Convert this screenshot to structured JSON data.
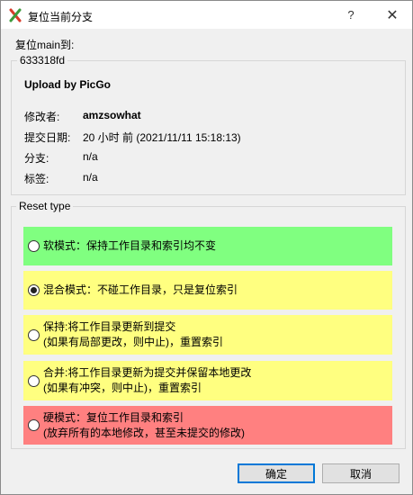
{
  "window": {
    "title": "复位当前分支",
    "help_glyph": "?",
    "close_glyph": "✕",
    "icon": "git-branch-icon"
  },
  "reset_label": "复位main到:",
  "commit": {
    "hash": "633318fd",
    "message": "Upload by PicGo",
    "author_label": "修改者:",
    "author_value": "amzsowhat",
    "date_label": "提交日期:",
    "date_value": "20 小时 前 (2021/11/11 15:18:13)",
    "branch_label": "分支:",
    "branch_value": "n/a",
    "tag_label": "标签:",
    "tag_value": "n/a"
  },
  "reset_type": {
    "legend": "Reset type",
    "options": [
      {
        "line1": "软模式：保持工作目录和索引均不变",
        "line2": "",
        "color": "#80ff80",
        "checked": false
      },
      {
        "line1": "混合模式：不碰工作目录，只是复位索引",
        "line2": "",
        "color": "#ffff80",
        "checked": true
      },
      {
        "line1": "保持:将工作目录更新到提交",
        "line2": "(如果有局部更改，则中止)，重置索引",
        "color": "#ffff80",
        "checked": false
      },
      {
        "line1": "合并:将工作目录更新为提交并保留本地更改",
        "line2": "(如果有冲突，则中止)，重置索引",
        "color": "#ffff80",
        "checked": false
      },
      {
        "line1": "硬模式：复位工作目录和索引",
        "line2": "(放弃所有的本地修改，甚至未提交的修改)",
        "color": "#ff8080",
        "checked": false
      }
    ]
  },
  "buttons": {
    "ok_label": "确定",
    "cancel_label": "取消"
  }
}
